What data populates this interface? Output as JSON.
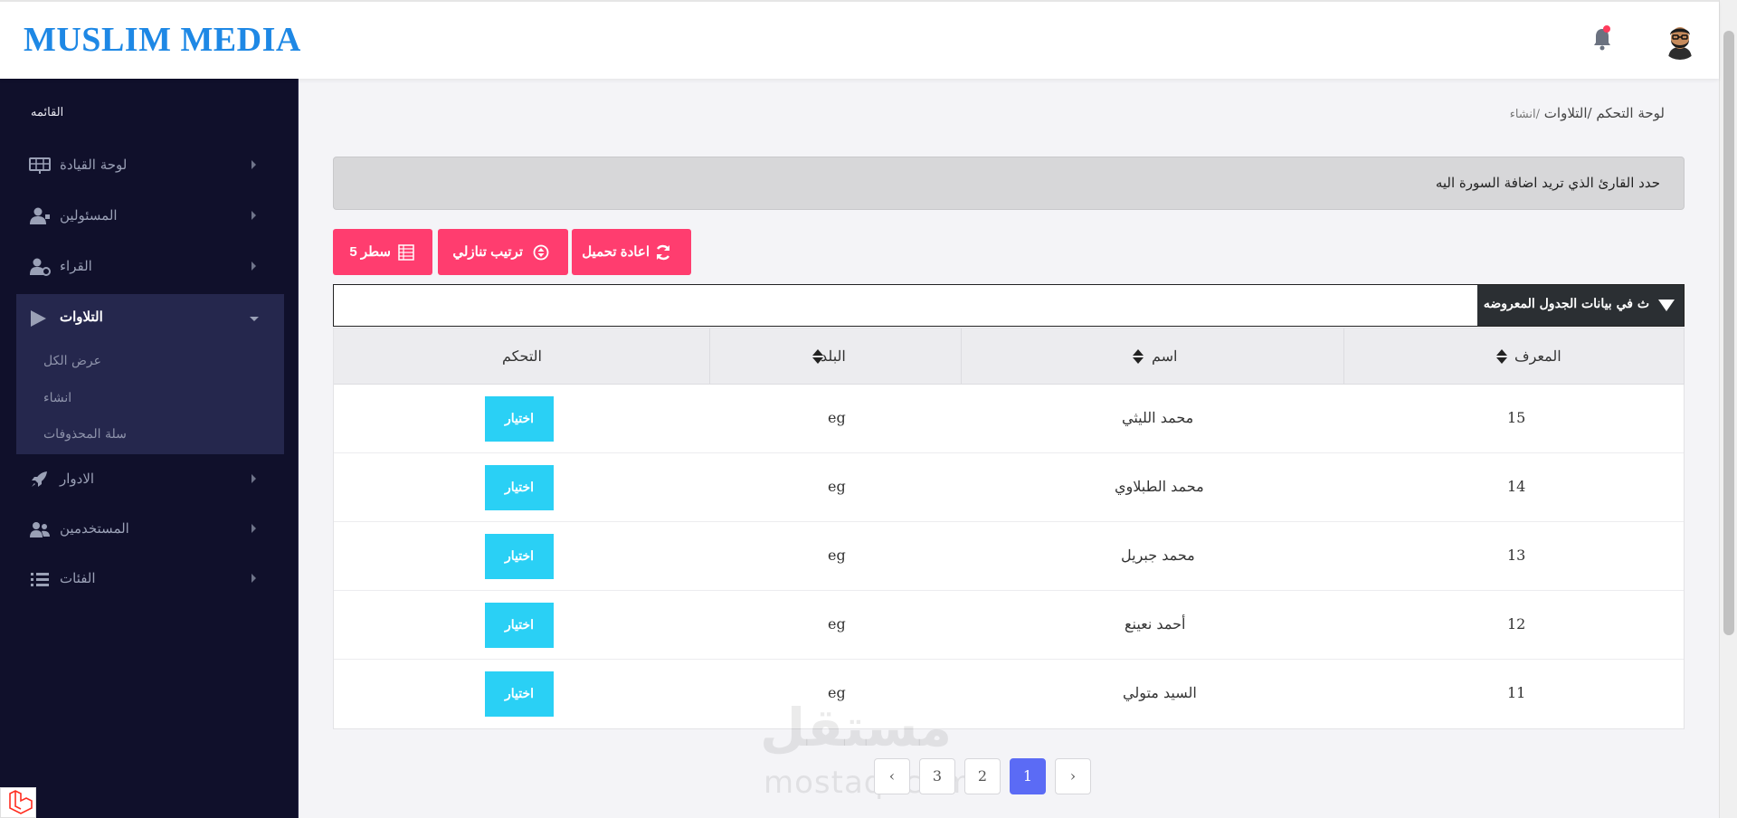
{
  "header": {
    "logo": "MUSLIM MEDIA"
  },
  "sidebar": {
    "heading": "القائمه",
    "items": [
      {
        "label": "لوحة القيادة",
        "icon": "dashboard-grid-icon"
      },
      {
        "label": "المسئولين",
        "icon": "user-tie-icon"
      },
      {
        "label": "القراء",
        "icon": "user-gear-icon"
      },
      {
        "label": "التلاوات",
        "icon": "play-icon"
      },
      {
        "label": "الادوار",
        "icon": "rocket-icon"
      },
      {
        "label": "المستخدمين",
        "icon": "users-icon"
      },
      {
        "label": "الفئات",
        "icon": "list-icon"
      }
    ],
    "submenu": [
      "عرض الكل",
      "انشاء",
      "سلة المحذوفات"
    ]
  },
  "breadcrumb": {
    "home": "لوحة التحكم",
    "section": "/التلاوات",
    "current": "/انشاء"
  },
  "alert": "حدد القارئ الذي تريد اضافة السورة اليه",
  "toolbar": {
    "rows_label": "سطر 5",
    "sort_label": "ترتيب تنازلي",
    "reload_label": "اعادة تحميل"
  },
  "search": {
    "caption": "ث في بيانات الجدول المعروضه",
    "value": ""
  },
  "table": {
    "headers": {
      "id": "المعرف",
      "name": "اسم",
      "country": "البلد",
      "actions": "التحكم"
    },
    "rows": [
      {
        "id": "15",
        "name": "محمد الليثي",
        "country": "eg",
        "action": "اختيار"
      },
      {
        "id": "14",
        "name": "محمد الطبلاوي",
        "country": "eg",
        "action": "اختيار"
      },
      {
        "id": "13",
        "name": "محمد جبريل",
        "country": "eg",
        "action": "اختيار"
      },
      {
        "id": "12",
        "name": "أحمد نعينع",
        "country": "eg",
        "action": "اختيار"
      },
      {
        "id": "11",
        "name": "السيد متولي",
        "country": "eg",
        "action": "اختيار"
      }
    ]
  },
  "pagination": {
    "prev": "‹",
    "next": "›",
    "pages": [
      "3",
      "2",
      "1"
    ],
    "active": "1"
  },
  "watermark": {
    "arabic": "مستقل",
    "latin": "mostaql.com"
  },
  "colors": {
    "sidebar_bg": "#10102b",
    "accent_pink": "#ff3d6f",
    "select_button": "#2ad0f5",
    "page_active": "#5b6bf5",
    "logo_blue": "#1e88e5"
  }
}
